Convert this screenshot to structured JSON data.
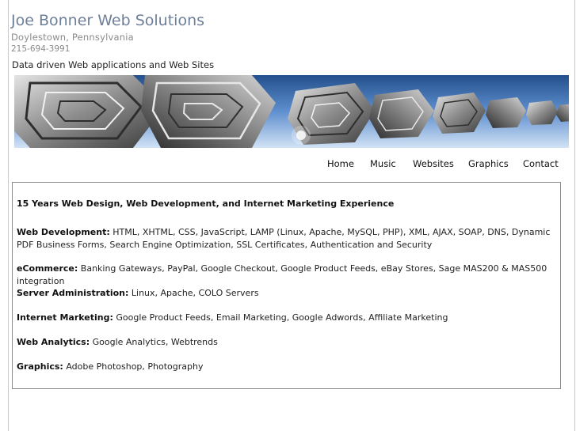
{
  "header": {
    "title": "Joe Bonner Web Solutions",
    "location": "Doylestown, Pennsylvania",
    "phone": "215-694-3991",
    "tagline": "Data driven Web applications and Web Sites"
  },
  "banner": {
    "description_icon": "abstract-metal-cubes-banner",
    "sky_color": "#6f9ad3"
  },
  "nav": {
    "items": [
      {
        "label": "Home"
      },
      {
        "label": "Music"
      },
      {
        "label": "Websites"
      },
      {
        "label": "Graphics"
      },
      {
        "label": "Contact"
      }
    ]
  },
  "content": {
    "headline": "15 Years Web Design, Web Development, and Internet Marketing Experience",
    "skills": [
      {
        "label": "Web Development:",
        "text": " HTML, XHTML, CSS, JavaScript, LAMP (Linux, Apache, MySQL, PHP), XML, AJAX, SOAP, DNS, Dynamic PDF Business Forms, Search Engine Optimization, SSL Certificates, Authentication and Security"
      },
      {
        "label": "eCommerce:",
        "text": " Banking Gateways, PayPal, Google Checkout, Google Product Feeds, eBay Stores, Sage MAS200 & MAS500 integration"
      },
      {
        "label": "Server Administration:",
        "text": " Linux, Apache, COLO Servers"
      },
      {
        "label": "Internet Marketing:",
        "text": " Google Product Feeds, Email Marketing, Google Adwords, Affiliate Marketing"
      },
      {
        "label": "Web Analytics:",
        "text": " Google Analytics, Webtrends"
      },
      {
        "label": "Graphics:",
        "text": " Adobe Photoshop, Photography"
      }
    ]
  },
  "colors": {
    "title": "#6e7f99",
    "muted": "#8a8a8a",
    "border": "#8a8a8a"
  }
}
